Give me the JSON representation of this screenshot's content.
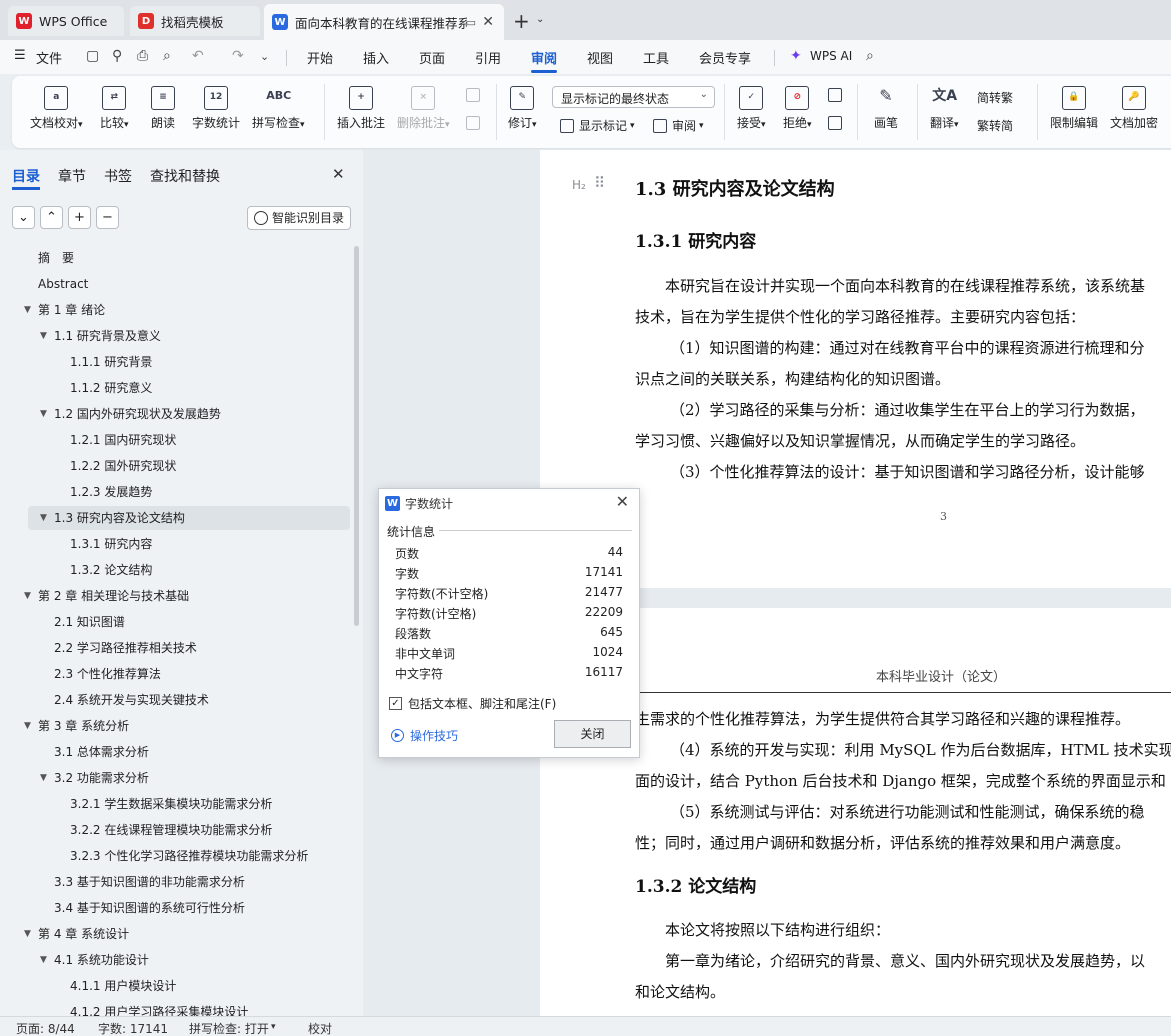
{
  "tabs": [
    {
      "label": "WPS Office",
      "icon": "wps-logo-icon",
      "color": "#e0202c"
    },
    {
      "label": "找稻壳模板",
      "icon": "docer-icon",
      "color": "#e0302c"
    },
    {
      "label": "面向本科教育的在线课程推荐系统",
      "icon": "word-doc-icon",
      "color": "#2a6ae0"
    }
  ],
  "menu": {
    "file": "文件",
    "items": [
      "开始",
      "插入",
      "页面",
      "引用",
      "审阅",
      "视图",
      "工具",
      "会员专享"
    ],
    "active": "审阅",
    "wps_ai": "WPS AI"
  },
  "ribbon": {
    "doc_proofread": "文档校对",
    "compare": "比较",
    "read_aloud": "朗读",
    "word_count": "字数统计",
    "word_count_icon_text": "12",
    "spell_check": "拼写检查",
    "spell_icon_text": "ABC",
    "insert_comment": "插入批注",
    "delete_comment": "删除批注",
    "track_changes": "修订",
    "display_mode": "显示标记的最终状态",
    "show_markup": "显示标记",
    "review": "审阅",
    "accept": "接受",
    "reject": "拒绝",
    "pen": "画笔",
    "translate": "翻译",
    "to_traditional": "简转繁",
    "to_simplified": "繁转简",
    "restrict_edit": "限制编辑",
    "encrypt": "文档加密"
  },
  "nav": {
    "tabs": [
      "目录",
      "章节",
      "书签",
      "查找和替换"
    ],
    "active_tab": "目录",
    "smart_toc": "智能识别目录",
    "toc": [
      {
        "text": "摘　要",
        "level": 0,
        "arrow": false
      },
      {
        "text": "Abstract",
        "level": 0,
        "arrow": false
      },
      {
        "text": "第 1 章  绪论",
        "level": 0,
        "arrow": true
      },
      {
        "text": "1.1  研究背景及意义",
        "level": 1,
        "arrow": true
      },
      {
        "text": "1.1.1  研究背景",
        "level": 2,
        "arrow": false
      },
      {
        "text": "1.1.2  研究意义",
        "level": 2,
        "arrow": false
      },
      {
        "text": "1.2  国内外研究现状及发展趋势",
        "level": 1,
        "arrow": true
      },
      {
        "text": "1.2.1  国内研究现状",
        "level": 2,
        "arrow": false
      },
      {
        "text": "1.2.2  国外研究现状",
        "level": 2,
        "arrow": false
      },
      {
        "text": "1.2.3  发展趋势",
        "level": 2,
        "arrow": false
      },
      {
        "text": "1.3  研究内容及论文结构",
        "level": 1,
        "arrow": true,
        "selected": true
      },
      {
        "text": "1.3.1  研究内容",
        "level": 2,
        "arrow": false
      },
      {
        "text": "1.3.2  论文结构",
        "level": 2,
        "arrow": false
      },
      {
        "text": "第 2 章  相关理论与技术基础",
        "level": 0,
        "arrow": true
      },
      {
        "text": "2.1  知识图谱",
        "level": 1,
        "arrow": false
      },
      {
        "text": "2.2  学习路径推荐相关技术",
        "level": 1,
        "arrow": false
      },
      {
        "text": "2.3  个性化推荐算法",
        "level": 1,
        "arrow": false
      },
      {
        "text": "2.4  系统开发与实现关键技术",
        "level": 1,
        "arrow": false
      },
      {
        "text": "第 3 章  系统分析",
        "level": 0,
        "arrow": true
      },
      {
        "text": "3.1  总体需求分析",
        "level": 1,
        "arrow": false
      },
      {
        "text": "3.2  功能需求分析",
        "level": 1,
        "arrow": true
      },
      {
        "text": "3.2.1 学生数据采集模块功能需求分析",
        "level": 2,
        "arrow": false
      },
      {
        "text": "3.2.2 在线课程管理模块功能需求分析",
        "level": 2,
        "arrow": false
      },
      {
        "text": "3.2.3 个性化学习路径推荐模块功能需求分析",
        "level": 2,
        "arrow": false
      },
      {
        "text": "3.3  基于知识图谱的非功能需求分析",
        "level": 1,
        "arrow": false
      },
      {
        "text": "3.4  基于知识图谱的系统可行性分析",
        "level": 1,
        "arrow": false
      },
      {
        "text": "第 4 章  系统设计",
        "level": 0,
        "arrow": true
      },
      {
        "text": "4.1  系统功能设计",
        "level": 1,
        "arrow": true
      },
      {
        "text": "4.1.1  用户模块设计",
        "level": 2,
        "arrow": false
      },
      {
        "text": "4.1.2  用户学习路径采集模块设计",
        "level": 2,
        "arrow": false
      }
    ]
  },
  "doc": {
    "page1": {
      "h2mark": "H₂",
      "h2": "1.3  研究内容及论文结构",
      "h3": "1.3.1  研究内容",
      "lines": [
        "本研究旨在设计并实现一个面向本科教育的在线课程推荐系统，该系统基",
        "技术，旨在为学生提供个性化的学习路径推荐。主要研究内容包括：",
        "（1）知识图谱的构建：通过对在线教育平台中的课程资源进行梳理和分",
        "识点之间的关联关系，构建结构化的知识图谱。",
        "（2）学习路径的采集与分析：通过收集学生在平台上的学习行为数据，",
        "学习习惯、兴趣偏好以及知识掌握情况，从而确定学生的学习路径。",
        "（3）个性化推荐算法的设计：基于知识图谱和学习路径分析，设计能够"
      ],
      "page_number": "3"
    },
    "page2": {
      "header": "本科毕业设计（论文）",
      "lines": [
        "生需求的个性化推荐算法，为学生提供符合其学习路径和兴趣的课程推荐。",
        "（4）系统的开发与实现：利用 MySQL 作为后台数据库，HTML 技术实现",
        "面的设计，结合 Python 后台技术和 Django 框架，完成整个系统的界面显示和",
        "（5）系统测试与评估：对系统进行功能测试和性能测试，确保系统的稳",
        "性；同时，通过用户调研和数据分析，评估系统的推荐效果和用户满意度。"
      ],
      "h3": "1.3.2  论文结构",
      "lines2": [
        "本论文将按照以下结构进行组织：",
        "第一章为绪论，介绍研究的背景、意义、国内外研究现状及发展趋势，以",
        "和论文结构。"
      ]
    }
  },
  "dialog": {
    "title": "字数统计",
    "section": "统计信息",
    "stats": [
      {
        "label": "页数",
        "value": "44"
      },
      {
        "label": "字数",
        "value": "17141"
      },
      {
        "label": "字符数(不计空格)",
        "value": "21477"
      },
      {
        "label": "字符数(计空格)",
        "value": "22209"
      },
      {
        "label": "段落数",
        "value": "645"
      },
      {
        "label": "非中文单词",
        "value": "1024"
      },
      {
        "label": "中文字符",
        "value": "16117"
      }
    ],
    "checkbox_label": "包括文本框、脚注和尾注(F)",
    "checkbox_checked": true,
    "tips": "操作技巧",
    "close": "关闭"
  },
  "status": {
    "page": "页面: 8/44",
    "words": "字数: 17141",
    "spell": "拼写检查: 打开",
    "proof": "校对"
  }
}
